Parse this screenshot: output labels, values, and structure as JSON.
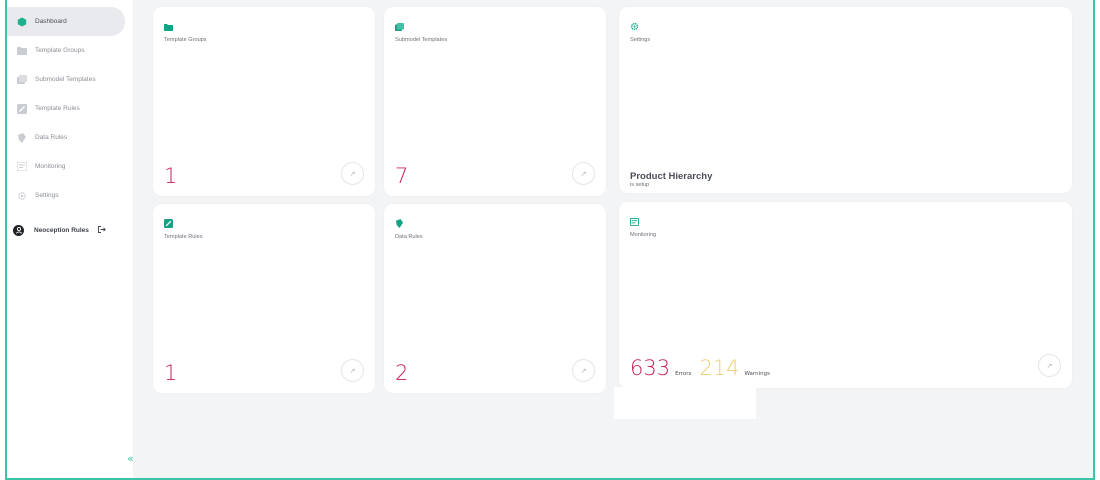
{
  "colors": {
    "accent": "#3cc3a8",
    "error": "#c8205a",
    "warning": "#f0cf72"
  },
  "sidebar": {
    "items": [
      {
        "label": "Dashboard",
        "icon": "hexagon-icon",
        "active": true
      },
      {
        "label": "Template Groups",
        "icon": "folder-icon",
        "active": false
      },
      {
        "label": "Submodel Templates",
        "icon": "templates-icon",
        "active": false
      },
      {
        "label": "Template Rules",
        "icon": "edit-icon",
        "active": false
      },
      {
        "label": "Data Rules",
        "icon": "tag-icon",
        "active": false
      },
      {
        "label": "Monitoring",
        "icon": "monitor-icon",
        "active": false
      },
      {
        "label": "Settings",
        "icon": "gear-icon",
        "active": false
      }
    ],
    "user": {
      "name": "Neoception Rules",
      "icon": "user-icon",
      "logout_icon": "logout-icon"
    },
    "collapse_icon": "chevrons-left-icon"
  },
  "cards": {
    "template_groups": {
      "title": "Template Groups",
      "value": "1",
      "icon": "folder-icon"
    },
    "submodel_templates": {
      "title": "Submodel Templates",
      "value": "7",
      "icon": "templates-icon"
    },
    "settings": {
      "title": "Settings",
      "icon": "gear-icon",
      "hierarchy_title": "Product Hierarchy",
      "hierarchy_status": "is setup"
    },
    "template_rules": {
      "title": "Template Rules",
      "value": "1",
      "icon": "edit-icon"
    },
    "data_rules": {
      "title": "Data Rules",
      "value": "2",
      "icon": "tag-icon"
    },
    "monitoring": {
      "title": "Monitoring",
      "icon": "monitor-icon",
      "errors_value": "633",
      "errors_label": "Errors",
      "warnings_value": "214",
      "warnings_label": "Warnings"
    }
  },
  "arrow_glyph": "↗"
}
